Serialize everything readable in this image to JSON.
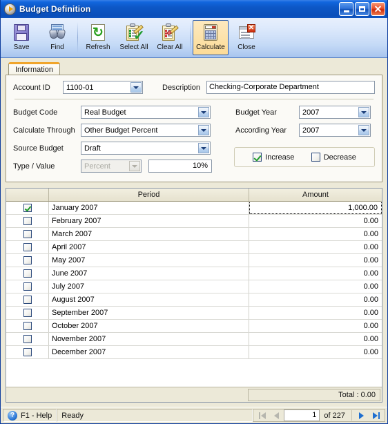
{
  "window": {
    "title": "Budget Definition",
    "icon": "app-badge-icon",
    "minimize_label": "_",
    "maximize_label": "",
    "close_label": "✕"
  },
  "toolbar": {
    "items": [
      {
        "label": "Save",
        "icon": "floppy-disk-icon",
        "active": false
      },
      {
        "label": "Find",
        "icon": "binoculars-icon",
        "active": false
      },
      {
        "label": "Refresh",
        "icon": "refresh-arrows-icon",
        "active": false
      },
      {
        "label": "Select All",
        "icon": "clipboard-check-icon",
        "active": false
      },
      {
        "label": "Clear All",
        "icon": "clipboard-eraser-icon",
        "active": false
      },
      {
        "label": "Calculate",
        "icon": "calculator-icon",
        "active": true
      },
      {
        "label": "Close",
        "icon": "window-close-icon",
        "active": false
      }
    ]
  },
  "tabs": [
    {
      "label": "Information",
      "active": true
    }
  ],
  "form": {
    "account_id_label": "Account ID",
    "account_id_value": "1100-01",
    "description_label": "Description",
    "description_value": "Checking-Corporate Department",
    "budget_code_label": "Budget Code",
    "budget_code_value": "Real Budget",
    "budget_year_label": "Budget Year",
    "budget_year_value": "2007",
    "calculate_through_label": "Calculate Through",
    "calculate_through_value": "Other Budget Percent",
    "according_year_label": "According Year",
    "according_year_value": "2007",
    "source_budget_label": "Source Budget",
    "source_budget_value": "Draft",
    "type_value_label": "Type / Value",
    "type_value": "Percent",
    "type_disabled": true,
    "value_amount": "10%",
    "increase_label": "Increase",
    "increase_checked": true,
    "decrease_label": "Decrease",
    "decrease_checked": false
  },
  "grid": {
    "columns": [
      "",
      "Period",
      "Amount"
    ],
    "rows": [
      {
        "checked": true,
        "period": "January 2007",
        "amount": "1,000.00",
        "focused": true
      },
      {
        "checked": false,
        "period": "February 2007",
        "amount": "0.00",
        "focused": false
      },
      {
        "checked": false,
        "period": "March 2007",
        "amount": "0.00",
        "focused": false
      },
      {
        "checked": false,
        "period": "April 2007",
        "amount": "0.00",
        "focused": false
      },
      {
        "checked": false,
        "period": "May 2007",
        "amount": "0.00",
        "focused": false
      },
      {
        "checked": false,
        "period": "June 2007",
        "amount": "0.00",
        "focused": false
      },
      {
        "checked": false,
        "period": "July 2007",
        "amount": "0.00",
        "focused": false
      },
      {
        "checked": false,
        "period": "August 2007",
        "amount": "0.00",
        "focused": false
      },
      {
        "checked": false,
        "period": "September 2007",
        "amount": "0.00",
        "focused": false
      },
      {
        "checked": false,
        "period": "October 2007",
        "amount": "0.00",
        "focused": false
      },
      {
        "checked": false,
        "period": "November 2007",
        "amount": "0.00",
        "focused": false
      },
      {
        "checked": false,
        "period": "December 2007",
        "amount": "0.00",
        "focused": false
      }
    ],
    "total_label": "Total : 0.00"
  },
  "statusbar": {
    "help_icon": "question-circle-icon",
    "help_label": "F1 - Help",
    "status_label": "Ready",
    "nav": {
      "first_enabled": false,
      "prev_enabled": false,
      "page_value": "1",
      "of_label": "of  227",
      "next_enabled": true,
      "last_enabled": true
    }
  }
}
